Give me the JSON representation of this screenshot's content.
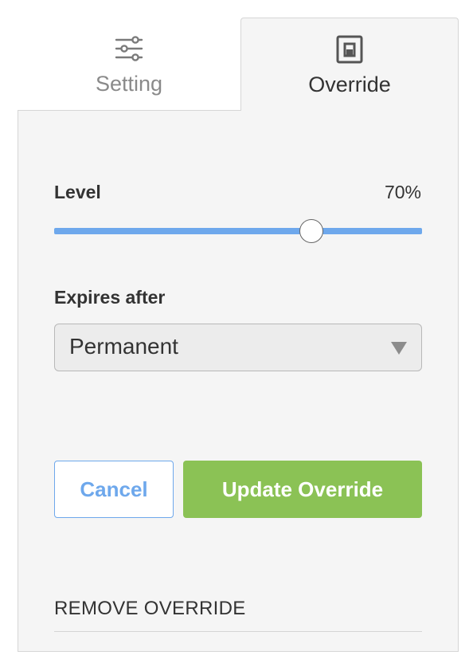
{
  "tabs": [
    {
      "label": "Setting",
      "icon": "sliders-icon",
      "active": false
    },
    {
      "label": "Override",
      "icon": "override-device-icon",
      "active": true
    }
  ],
  "level": {
    "label": "Level",
    "value_text": "70%",
    "value": 0.7,
    "track_color": "#6ea8ec"
  },
  "expires": {
    "label": "Expires after",
    "selected": "Permanent"
  },
  "buttons": {
    "cancel": "Cancel",
    "update": "Update Override",
    "update_color": "#8bc255"
  },
  "remove": {
    "label": "REMOVE OVERRIDE"
  }
}
